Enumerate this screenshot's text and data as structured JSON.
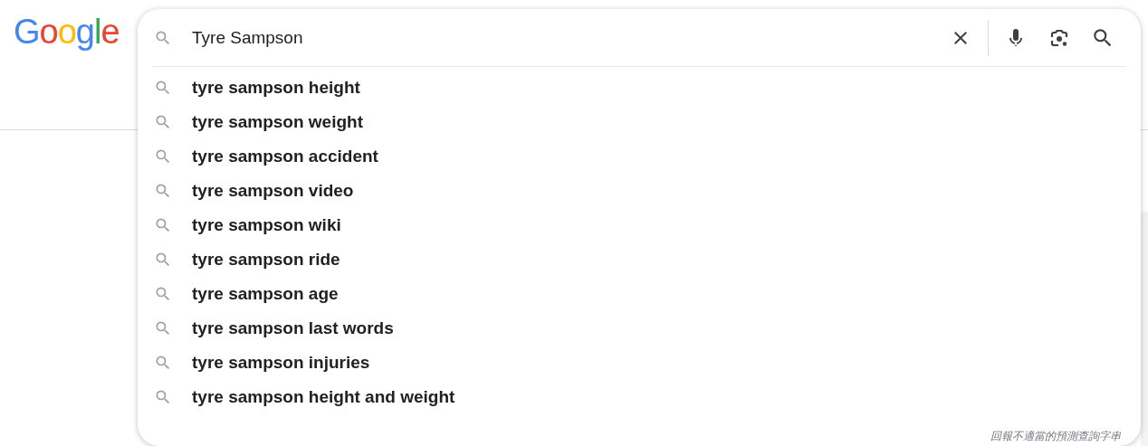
{
  "logo": "Google",
  "search": {
    "value": "Tyre Sampson"
  },
  "suggestions": [
    {
      "text": "tyre sampson height"
    },
    {
      "text": "tyre sampson weight"
    },
    {
      "text": "tyre sampson accident"
    },
    {
      "text": "tyre sampson video"
    },
    {
      "text": "tyre sampson wiki"
    },
    {
      "text": "tyre sampson ride"
    },
    {
      "text": "tyre sampson age"
    },
    {
      "text": "tyre sampson last words"
    },
    {
      "text": "tyre sampson injuries"
    },
    {
      "text": "tyre sampson height and weight"
    }
  ],
  "report_link": "回報不適當的預測查詢字串"
}
